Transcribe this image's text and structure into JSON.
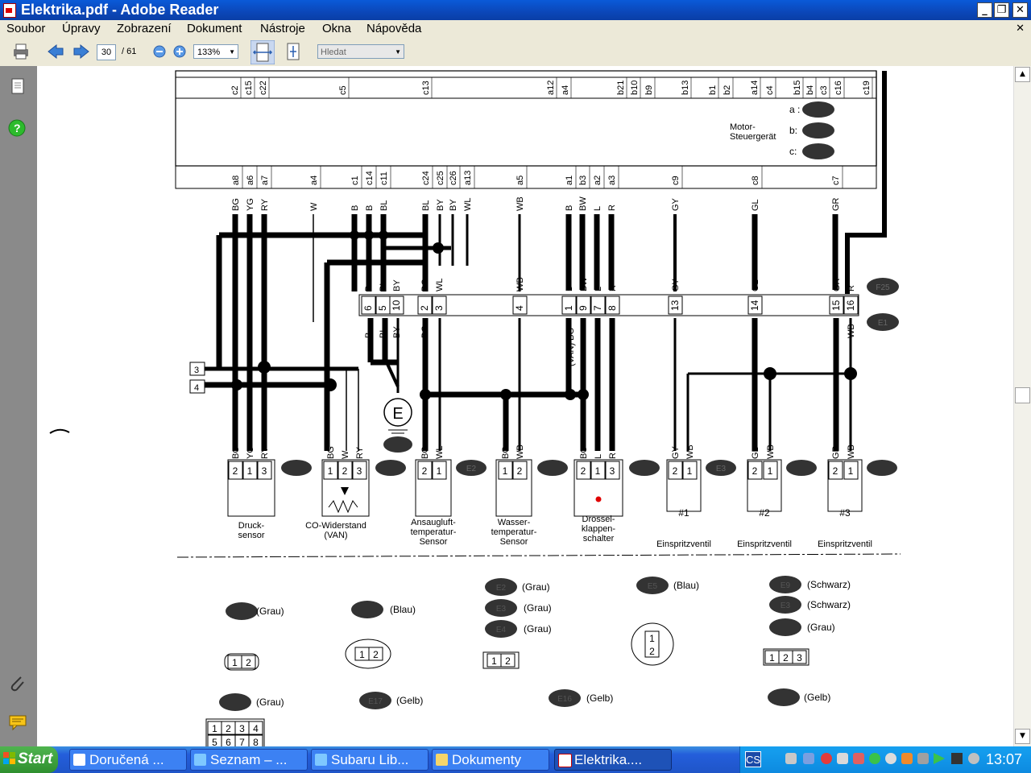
{
  "window": {
    "title": "Elektrika.pdf - Adobe Reader"
  },
  "menu": {
    "items": [
      "Soubor",
      "Úpravy",
      "Zobrazení",
      "Dokument",
      "Nástroje",
      "Okna",
      "Nápověda"
    ]
  },
  "toolbar": {
    "page": "30",
    "page_total": "/ 61",
    "zoom": "133%",
    "search_placeholder": "Hledat"
  },
  "diagram": {
    "ecu_label": [
      "Motor-",
      "Steuergerät"
    ],
    "ecu_slots": [
      "a :",
      "b:",
      "c:"
    ],
    "top_pins": [
      "c2",
      "c15",
      "c22",
      "c5",
      "c13",
      "a12",
      "a4",
      "b21",
      "b10",
      "b9",
      "b13",
      "b1",
      "b2",
      "a14",
      "c4",
      "b15",
      "b4",
      "c3",
      "c16",
      "c19"
    ],
    "upper_pins": [
      "a8",
      "a6",
      "a7",
      "a4",
      "c1",
      "c14",
      "c11",
      "c24",
      "c25",
      "c26",
      "a13",
      "a5",
      "a1",
      "b3",
      "a2",
      "a3",
      "c9",
      "c8",
      "c7"
    ],
    "upper_wires": [
      "BG",
      "YG",
      "RY",
      "W",
      "B",
      "B",
      "BL",
      "BL",
      "BY",
      "BY",
      "WL",
      "WB",
      "B",
      "BW",
      "L",
      "R",
      "GY",
      "GL",
      "GR"
    ],
    "connector_top": [
      "B",
      "BL",
      "BY",
      "BG",
      "WL",
      "WB",
      "B",
      "BW",
      "L",
      "R",
      "GY",
      "GL",
      "GR",
      "R"
    ],
    "connector_pins": [
      "6",
      "5",
      "10",
      "2",
      "3",
      "4",
      "1",
      "9",
      "7",
      "8",
      "13",
      "14",
      "15",
      "16"
    ],
    "connector_bottom": [
      "B",
      "BL",
      "BY",
      "BG",
      "(VAN) BG",
      "BG",
      "WB"
    ],
    "connector_refs": [
      "F25",
      "E1"
    ],
    "side_boxes": [
      "3",
      "4"
    ],
    "ground": "E",
    "sensor_wires": [
      "BG",
      "YG",
      "RY",
      "BG",
      "W",
      "RY",
      "BG",
      "WL",
      "BG",
      "WB",
      "BG",
      "L",
      "R",
      "GY",
      "WB",
      "GL",
      "WB",
      "GR",
      "WB"
    ],
    "components": [
      {
        "pins": [
          "2",
          "1",
          "3"
        ],
        "label": [
          "Druck-",
          "sensor"
        ]
      },
      {
        "pins": [
          "1",
          "2",
          "3"
        ],
        "label": [
          "CO-Widerstand",
          "(VAN)"
        ]
      },
      {
        "pins": [
          "2",
          "1"
        ],
        "label": [
          "Ansaugluft-",
          "temperatur-",
          "Sensor"
        ],
        "ref": "E2"
      },
      {
        "pins": [
          "1",
          "2"
        ],
        "label": [
          "Wasser-",
          "temperatur-",
          "Sensor"
        ]
      },
      {
        "pins": [
          "2",
          "1",
          "3"
        ],
        "label": [
          "Drossel-",
          "klappen-",
          "schalter"
        ]
      },
      {
        "pins": [
          "2",
          "1"
        ],
        "label": [
          "Einspritzventil"
        ],
        "num": "#1",
        "ref": "E3"
      },
      {
        "pins": [
          "2",
          "1"
        ],
        "label": [
          "Einspritzventil"
        ],
        "num": "#2"
      },
      {
        "pins": [
          "2",
          "1"
        ],
        "label": [
          "Einspritzventil"
        ],
        "num": "#3"
      }
    ],
    "legend": [
      {
        "text": "(Grau)"
      },
      {
        "text": "(Blau)"
      },
      {
        "text": "(Grau)"
      },
      {
        "text": "(Grau)"
      },
      {
        "text": "(Grau)"
      },
      {
        "text": "(Blau)"
      },
      {
        "text": "(Schwarz)"
      },
      {
        "text": "(Schwarz)"
      },
      {
        "text": "(Grau)"
      },
      {
        "text": "(Grau)"
      },
      {
        "text": "(Gelb)"
      },
      {
        "text": "(Gelb)"
      },
      {
        "text": "(Gelb)"
      }
    ],
    "legend_refs": [
      "E2",
      "E3",
      "E4",
      "E5",
      "E9",
      "E3",
      "E17",
      "E16"
    ],
    "small_connectors": [
      [
        "1",
        "2"
      ],
      [
        "1",
        "2"
      ],
      [
        "1",
        "2"
      ],
      [
        "1",
        "2"
      ],
      [
        "1",
        "2",
        "3"
      ],
      [
        "1",
        "2",
        "3",
        "4"
      ],
      [
        "5",
        "6",
        "7",
        "8"
      ]
    ]
  },
  "taskbar": {
    "start": "Start",
    "tasks": [
      "Doručená ...",
      "Seznam – ...",
      "Subaru Lib...",
      "Dokumenty",
      "Elektrika...."
    ],
    "tray_label": "CS",
    "clock": "13:07"
  }
}
